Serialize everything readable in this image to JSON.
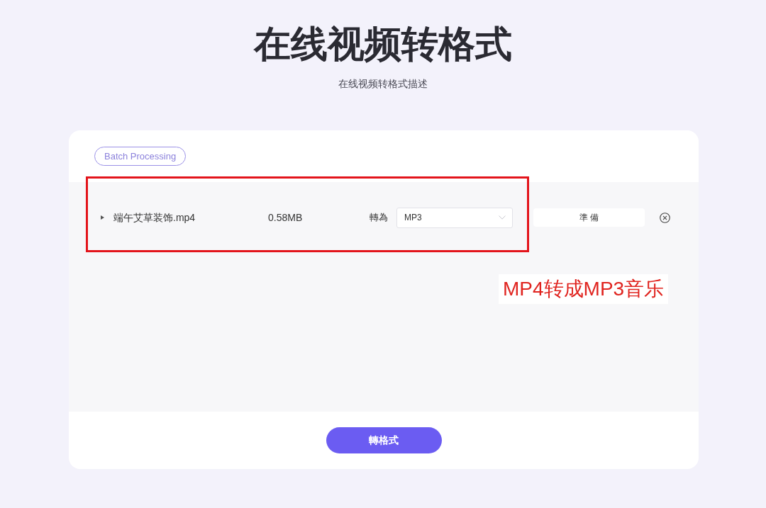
{
  "header": {
    "title": "在线视频转格式",
    "description": "在线视频转格式描述"
  },
  "panel": {
    "batch_button": "Batch Processing",
    "files": [
      {
        "name": "端午艾草装饰.mp4",
        "size": "0.58MB",
        "convert_label": "轉為",
        "format": "MP3",
        "status": "準 備"
      }
    ],
    "convert_button": "轉格式"
  },
  "annotation": {
    "text": "MP4转成MP3音乐"
  }
}
